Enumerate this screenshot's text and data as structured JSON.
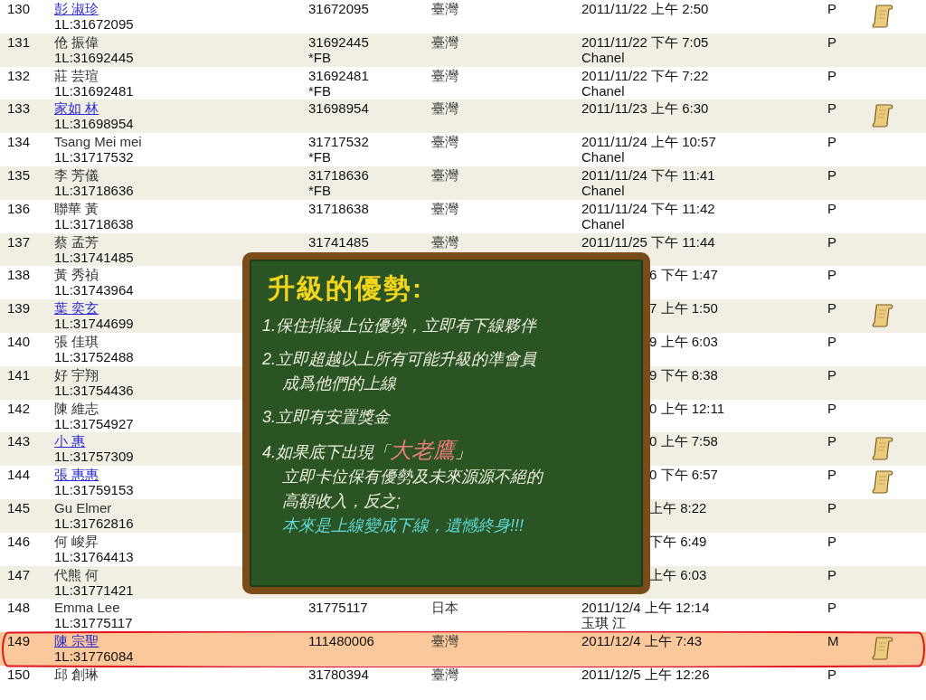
{
  "rows": [
    {
      "no": "130",
      "name": "彭 淑珍",
      "link": true,
      "sponsor": "1L:31672095",
      "member_id": "31672095",
      "country": "臺灣",
      "date": "2011/11/22 上午 2:50",
      "status": "P",
      "scroll": true,
      "selected": false,
      "kind": "full"
    },
    {
      "no": "131",
      "name": "伧 振偉",
      "link": false,
      "sponsor": "1L:31692445",
      "member_id": "31692445",
      "source": "*FB",
      "country": "臺灣",
      "date": "2011/11/22 下午 7:05",
      "referrer": "Chanel",
      "status": "P",
      "scroll": false,
      "selected": false,
      "kind": "full"
    },
    {
      "no": "132",
      "name": "莊 芸瑄",
      "link": false,
      "sponsor": "1L:31692481",
      "member_id": "31692481",
      "source": "*FB",
      "country": "臺灣",
      "date": "2011/11/22 下午 7:22",
      "referrer": "Chanel",
      "status": "P",
      "scroll": false,
      "selected": false,
      "kind": "full"
    },
    {
      "no": "133",
      "name": "家如 林",
      "link": true,
      "sponsor": "1L:31698954",
      "member_id": "31698954",
      "country": "臺灣",
      "date": "2011/11/23 上午 6:30",
      "status": "P",
      "scroll": true,
      "selected": false,
      "kind": "full"
    },
    {
      "no": "134",
      "name": "Tsang Mei mei",
      "link": false,
      "sponsor": "1L:31717532",
      "member_id": "31717532",
      "source": "*FB",
      "country": "臺灣",
      "date": "2011/11/24 上午 10:57",
      "referrer": "Chanel",
      "status": "P",
      "scroll": false,
      "selected": false,
      "kind": "full"
    },
    {
      "no": "135",
      "name": "李 芳儀",
      "link": false,
      "sponsor": "1L:31718636",
      "member_id": "31718636",
      "source": "*FB",
      "country": "臺灣",
      "date": "2011/11/24 下午 11:41",
      "referrer": "Chanel",
      "status": "P",
      "scroll": false,
      "selected": false,
      "kind": "full"
    },
    {
      "no": "136",
      "name": "聯華 黃",
      "link": false,
      "sponsor": "1L:31718638",
      "member_id": "31718638",
      "country": "臺灣",
      "date": "2011/11/24 下午 11:42",
      "referrer": "Chanel",
      "status": "P",
      "scroll": false,
      "selected": false,
      "kind": "full"
    },
    {
      "no": "137",
      "name": "蔡 孟芳",
      "link": false,
      "sponsor": "1L:31741485",
      "member_id": "31741485",
      "country": "臺灣",
      "date": "2011/11/25 下午 11:44",
      "status": "P",
      "scroll": false,
      "selected": false,
      "kind": "full"
    },
    {
      "no": "138",
      "name": "黃 秀禎",
      "link": false,
      "sponsor": "1L:31743964",
      "date": "6 下午 1:47",
      "status": "P",
      "scroll": false,
      "selected": false,
      "kind": "covered"
    },
    {
      "no": "139",
      "name": "葉 奕玄",
      "link": true,
      "sponsor": "1L:31744699",
      "date": "7 上午 1:50",
      "status": "P",
      "scroll": true,
      "selected": false,
      "kind": "covered"
    },
    {
      "no": "140",
      "name": "張 佳琪",
      "link": false,
      "sponsor": "1L:31752488",
      "date": "9 上午 6:03",
      "status": "P",
      "scroll": false,
      "selected": false,
      "kind": "covered"
    },
    {
      "no": "141",
      "name": "好 宇翔",
      "link": false,
      "sponsor": "1L:31754436",
      "date": "9 下午 8:38",
      "status": "P",
      "scroll": false,
      "selected": false,
      "kind": "covered"
    },
    {
      "no": "142",
      "name": "陳 維志",
      "link": false,
      "sponsor": "1L:31754927",
      "date": "0 上午 12:11",
      "status": "P",
      "scroll": false,
      "selected": false,
      "kind": "covered"
    },
    {
      "no": "143",
      "name": "小 惠",
      "link": true,
      "sponsor": "1L:31757309",
      "date": "0 上午 7:58",
      "status": "P",
      "scroll": true,
      "selected": false,
      "kind": "covered"
    },
    {
      "no": "144",
      "name": "張 惠惠",
      "link": true,
      "sponsor": "1L:31759153",
      "date": "0 下午 6:57",
      "status": "P",
      "scroll": true,
      "selected": false,
      "kind": "covered"
    },
    {
      "no": "145",
      "name": "Gu Elmer",
      "link": false,
      "sponsor": "1L:31762816",
      "date": "上午 8:22",
      "status": "P",
      "scroll": false,
      "selected": false,
      "kind": "covered"
    },
    {
      "no": "146",
      "name": "何 峻昇",
      "link": false,
      "sponsor": "1L:31764413",
      "date": "下午 6:49",
      "status": "P",
      "scroll": false,
      "selected": false,
      "kind": "covered"
    },
    {
      "no": "147",
      "name": "代熊 何",
      "link": false,
      "sponsor": "1L:31771421",
      "date": "上午 6:03",
      "status": "P",
      "scroll": false,
      "selected": false,
      "kind": "covered"
    },
    {
      "no": "148",
      "name": "Emma Lee",
      "link": false,
      "sponsor": "1L:31775117",
      "member_id": "31775117",
      "country": "日本",
      "date": "2011/12/4 上午 12:14",
      "referrer": "玉琪 江",
      "status": "P",
      "scroll": false,
      "selected": false,
      "kind": "full"
    },
    {
      "no": "149",
      "name": "陳 宗聖",
      "link": true,
      "sponsor": "1L:31776084",
      "member_id": "111480006",
      "country": "臺灣",
      "date": "2011/12/4 上午 7:43",
      "status": "M",
      "scroll": true,
      "selected": true,
      "kind": "full"
    },
    {
      "no": "150",
      "name": "邱 創琳",
      "link": false,
      "member_id": "31780394",
      "country": "臺灣",
      "date": "2011/12/5 上午 12:26",
      "status": "P",
      "scroll": false,
      "selected": false,
      "kind": "full"
    }
  ],
  "board": {
    "title": "升級的優勢:",
    "lines": [
      {
        "kind": "item",
        "text": "1.保住排線上位優勢，立即有下線夥伴"
      },
      {
        "kind": "item",
        "text": "2.立即超越以上所有可能升級的準會員"
      },
      {
        "kind": "cont",
        "text": "成爲他們的上線"
      },
      {
        "kind": "item",
        "text": "3.立即有安置獎金"
      },
      {
        "kind": "callout",
        "before": "4.如果底下出現「",
        "highlight": "大老鷹",
        "after": "」"
      },
      {
        "kind": "cont",
        "text": "立即卡位保有優勢及未來源源不絕的"
      },
      {
        "kind": "cont",
        "text": "高額收入，反之;"
      },
      {
        "kind": "warning",
        "text": "本來是上線變成下線，遺憾終身!!!"
      }
    ]
  }
}
